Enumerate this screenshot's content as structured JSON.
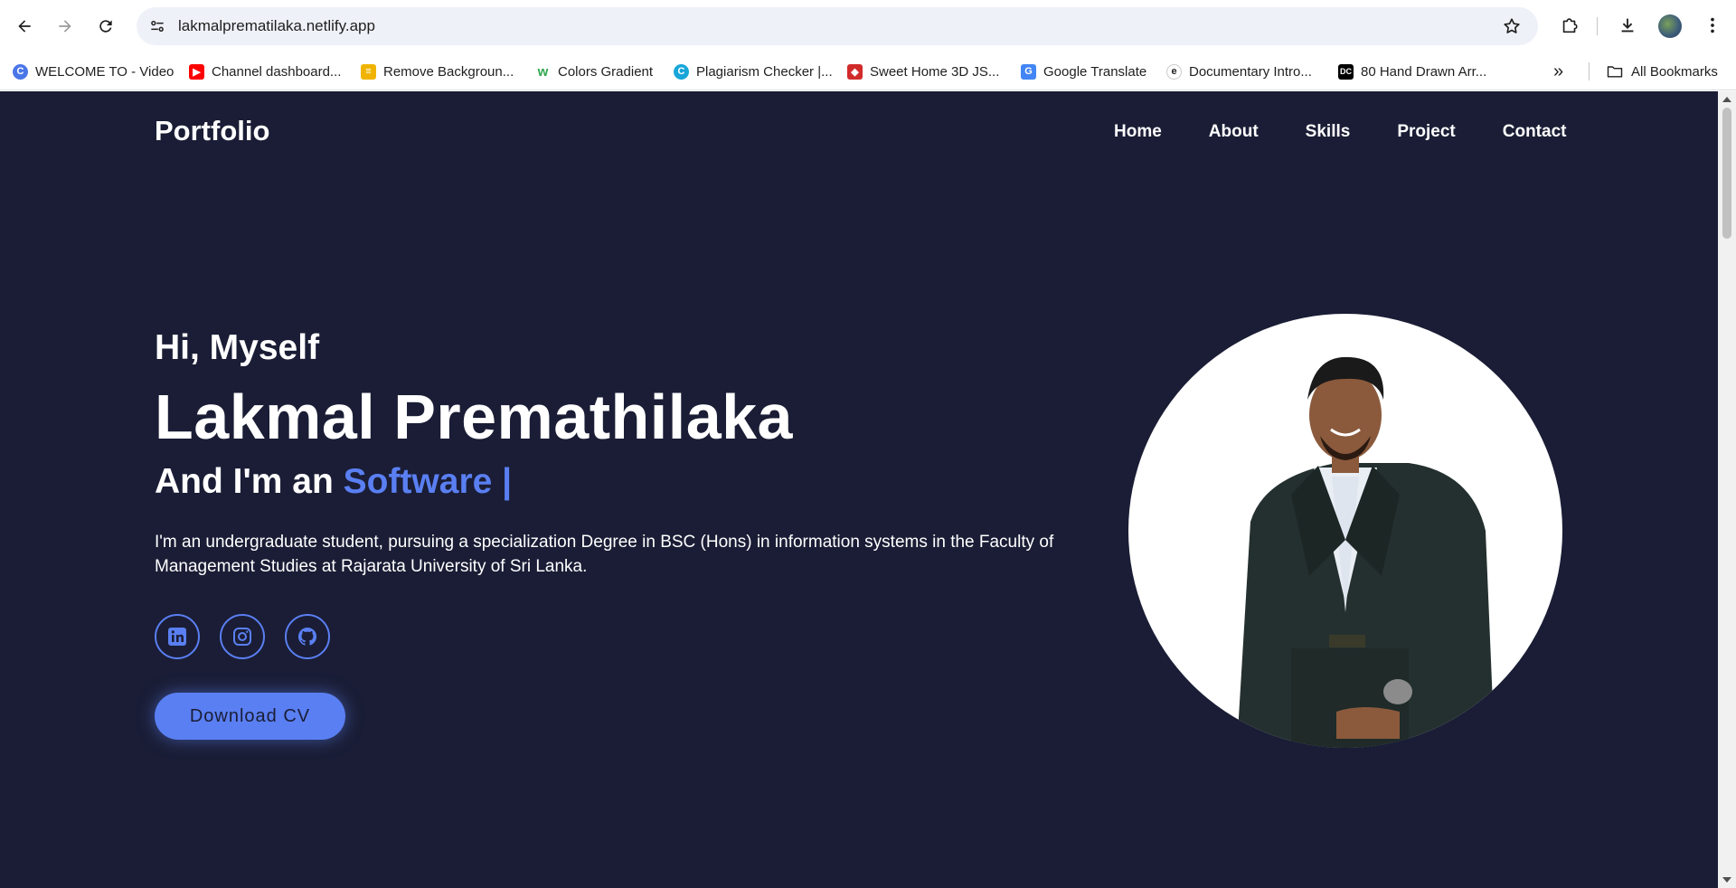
{
  "browser": {
    "url": "lakmalprematilaka.netlify.app",
    "bookmarks": [
      {
        "label": "WELCOME TO - Video",
        "icon": "c-logo-icon",
        "color": "#4a76e8"
      },
      {
        "label": "Channel dashboard...",
        "icon": "youtube-icon",
        "color": "#ff0000"
      },
      {
        "label": "Remove Backgroun...",
        "icon": "stack-icon",
        "color": "#f0b400"
      },
      {
        "label": "Colors Gradient",
        "icon": "w-logo-icon",
        "color": "#2fa84f"
      },
      {
        "label": "Plagiarism Checker |...",
        "icon": "c-plag-icon",
        "color": "#18a6d9"
      },
      {
        "label": "Sweet Home 3D JS...",
        "icon": "cube-icon",
        "color": "#d12a2a"
      },
      {
        "label": "Google Translate",
        "icon": "translate-icon",
        "color": "#4285f4"
      },
      {
        "label": "Documentary Intro...",
        "icon": "e-logo-icon",
        "color": "#222222"
      },
      {
        "label": "80 Hand Drawn Arr...",
        "icon": "dc-logo-icon",
        "color": "#000000"
      }
    ],
    "all_bookmarks": "All Bookmarks"
  },
  "page": {
    "logo": "Portfolio",
    "nav": [
      "Home",
      "About",
      "Skills",
      "Project",
      "Contact"
    ],
    "greeting": "Hi, Myself",
    "name": "Lakmal Premathilaka",
    "role_prefix": "And I'm an ",
    "role_highlight": "Software |",
    "bio": "I'm an undergraduate student, pursuing a specialization Degree in BSC (Hons) in information systems in the Faculty of Management Studies at Rajarata University of Sri Lanka.",
    "socials": [
      "linkedin-icon",
      "instagram-icon",
      "github-icon"
    ],
    "cv_button": "Download CV",
    "colors": {
      "background": "#1a1d35",
      "accent": "#5a7ff2",
      "text": "#ffffff"
    }
  }
}
